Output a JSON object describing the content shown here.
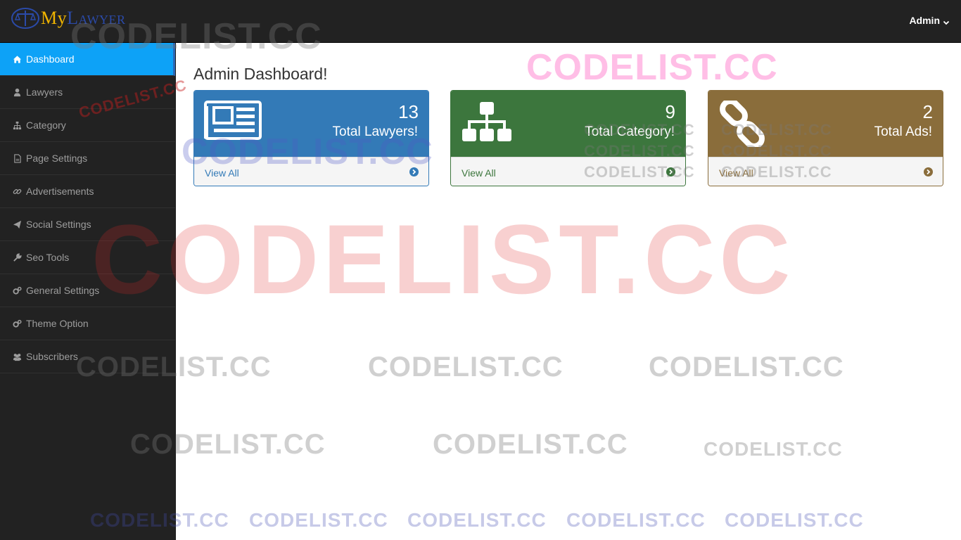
{
  "brand": {
    "my": "My",
    "lawyer": "Lawyer"
  },
  "header": {
    "user_menu": "Admin"
  },
  "sidebar": {
    "items": [
      {
        "label": "Dashboard",
        "icon": "home-icon",
        "active": true
      },
      {
        "label": "Lawyers",
        "icon": "user-tie-icon"
      },
      {
        "label": "Category",
        "icon": "sitemap-icon"
      },
      {
        "label": "Page Settings",
        "icon": "file-icon"
      },
      {
        "label": "Advertisements",
        "icon": "link-icon"
      },
      {
        "label": "Social Settings",
        "icon": "paper-plane-icon"
      },
      {
        "label": "Seo Tools",
        "icon": "wrench-icon"
      },
      {
        "label": "General Settings",
        "icon": "cogs-icon"
      },
      {
        "label": "Theme Option",
        "icon": "cogs-icon"
      },
      {
        "label": "Subscribers",
        "icon": "users-icon"
      }
    ]
  },
  "main": {
    "title": "Admin Dashboard!",
    "panels": [
      {
        "count": "13",
        "label": "Total Lawyers!",
        "link": "View All",
        "icon": "newspaper-icon",
        "color": "#337ab7"
      },
      {
        "count": "9",
        "label": "Total Category!",
        "link": "View All",
        "icon": "sitemap-icon",
        "color": "#3c763d"
      },
      {
        "count": "2",
        "label": "Total Ads!",
        "link": "View All",
        "icon": "chain-link-icon",
        "color": "#8a6d3b"
      }
    ]
  },
  "watermark": {
    "text": "CODELIST.CC"
  },
  "colors": {
    "topbar": "#222222",
    "sidebar": "#222222",
    "active": "#0da2f7"
  }
}
